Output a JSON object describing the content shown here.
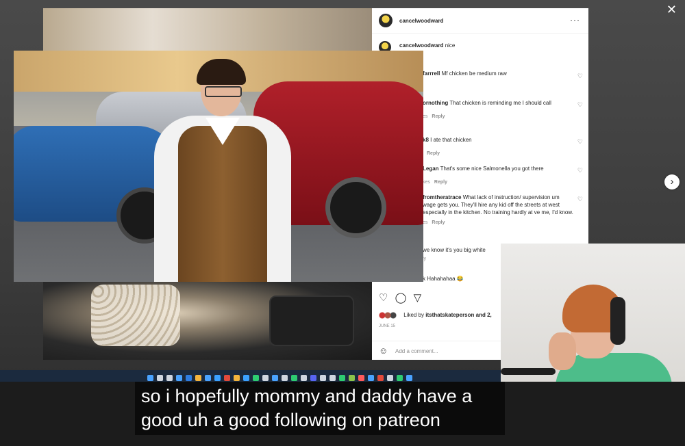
{
  "window": {
    "close_glyph": "✕",
    "next_glyph": "›"
  },
  "post": {
    "author": "cancelwoodward",
    "more_glyph": "···",
    "first_comment": {
      "user": "cancelwoodward",
      "text": "nice"
    },
    "comments": [
      {
        "user": "farrrell",
        "text": "Mf chicken be medium raw",
        "sub_left": "",
        "reply": ""
      },
      {
        "user": "ornothing",
        "text": "That chicken is reminding me I should call",
        "sub_left": "es",
        "reply": "Reply"
      },
      {
        "user": "k8",
        "text": "I ate that chicken",
        "sub_left": "",
        "reply": "Reply"
      },
      {
        "user": "Legan",
        "text": "That's some nice Salmonella you got there",
        "sub_left": "kes",
        "reply": "Reply"
      },
      {
        "user": "fromtheratrace",
        "text": "What lack of instruction/ supervision um wage gets you. They'll hire any kid off the streets at west especially in the kitchen. No training hardly at ve me, I'd know.",
        "sub_left": "es",
        "reply": "Reply"
      },
      {
        "user": "",
        "text": "we know it's you big white",
        "sub_left": "ly",
        "reply": ""
      },
      {
        "user": "",
        "text": "k Hahahahaa 😂",
        "sub_left": "",
        "reply": ""
      }
    ],
    "actions": {
      "heart": "♡",
      "comment": "◯",
      "share": "▽"
    },
    "likes_prefix": "Liked by",
    "likes_user": "itsthatskateperson",
    "likes_suffix": "and 2,",
    "date": "JUNE 15",
    "add_comment_placeholder": "Add a comment...",
    "heart_glyph": "♡",
    "smile_glyph": "☺"
  },
  "caption": {
    "line1": "so i hopefully mommy and daddy have a",
    "line2": "good uh a good following on patreon"
  },
  "taskbar": {
    "icon_colors": [
      "#4aa3ff",
      "#cfd6e0",
      "#cfd6e0",
      "#4aa3ff",
      "#2e7de1",
      "#f2b33d",
      "#4aa3ff",
      "#3ba1ff",
      "#e24a3b",
      "#f2b33d",
      "#3ba1ff",
      "#2ecc71",
      "#cfd6e0",
      "#4aa3ff",
      "#cfd6e0",
      "#2ecc71",
      "#cfd6e0",
      "#5865f2",
      "#cfd6e0",
      "#cfd6e0",
      "#2ecc71",
      "#8bc34a",
      "#ff5a5a",
      "#4aa3ff",
      "#e24a3b",
      "#cfd6e0",
      "#2ecc71",
      "#4aa3ff"
    ]
  }
}
